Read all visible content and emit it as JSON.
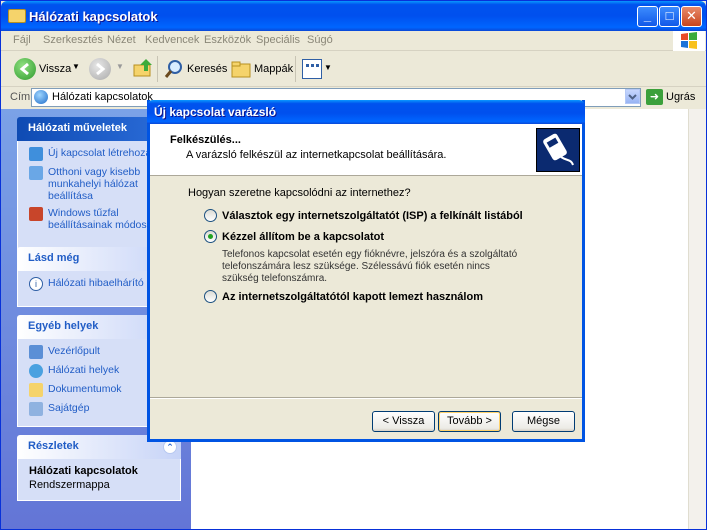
{
  "window": {
    "title": "Hálózati kapcsolatok"
  },
  "menu": [
    "Fájl",
    "Szerkesztés",
    "Nézet",
    "Kedvencek",
    "Eszközök",
    "Speciális",
    "Súgó"
  ],
  "toolbar": {
    "back_label": "Vissza",
    "search_label": "Keresés",
    "folders_label": "Mappák"
  },
  "address": {
    "label": "Cím",
    "value": "Hálózati kapcsolatok",
    "go_label": "Ugrás"
  },
  "left_pane": {
    "network_tasks": {
      "title": "Hálózati műveletek",
      "items": [
        "Új kapcsolat létrehozása",
        "Otthoni vagy kisebb munkahelyi hálózat beállítása",
        "Windows tűzfal beállításainak módosítása"
      ]
    },
    "see_also": {
      "title": "Lásd még",
      "items": [
        "Hálózati hibaelhárító"
      ]
    },
    "other_places": {
      "title": "Egyéb helyek",
      "items": [
        "Vezérlőpult",
        "Hálózati helyek",
        "Dokumentumok",
        "Sajátgép"
      ]
    },
    "details": {
      "title": "Részletek",
      "name": "Hálózati kapcsolatok",
      "type": "Rendszermappa"
    }
  },
  "dialog": {
    "title": "Új kapcsolat varázsló",
    "heading": "Felkészülés...",
    "subheading": "A varázsló felkészül az internetkapcsolat beállítására.",
    "question": "Hogyan szeretne kapcsolódni az internethez?",
    "options": [
      "Választok egy internetszolgáltatót (ISP) a felkínált listából",
      "Kézzel állítom be a kapcsolatot",
      "Az internetszolgáltatótól kapott lemezt használom"
    ],
    "selected_option": 1,
    "manual_description": "Telefonos kapcsolat esetén egy fióknévre, jelszóra és a szolgáltató telefonszámára lesz szüksége. Szélessávú fiók esetén nincs szükség telefonszámra.",
    "buttons": {
      "back": "< Vissza",
      "next": "Tovább >",
      "cancel": "Mégse"
    }
  },
  "colors": {
    "titlebar": "#0054e3",
    "task_text": "#215dc6",
    "pane_bg": "#6f8fe0",
    "radio_dot": "#21a121"
  }
}
